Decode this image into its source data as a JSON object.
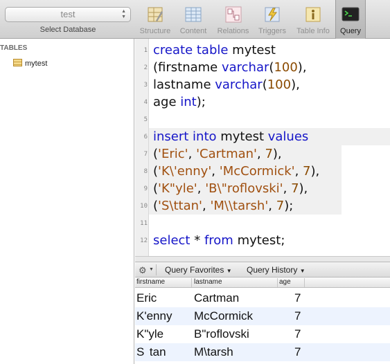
{
  "toolbar": {
    "database": "test",
    "database_caption": "Select Database",
    "buttons": [
      {
        "label": "Structure",
        "icon": "structure-icon"
      },
      {
        "label": "Content",
        "icon": "content-icon"
      },
      {
        "label": "Relations",
        "icon": "relations-icon"
      },
      {
        "label": "Triggers",
        "icon": "triggers-icon"
      },
      {
        "label": "Table Info",
        "icon": "table-info-icon"
      },
      {
        "label": "Query",
        "icon": "query-terminal-icon",
        "active": true
      }
    ]
  },
  "sidebar": {
    "heading": "TABLES",
    "tables": [
      "mytest"
    ]
  },
  "editor": {
    "line_numbers": [
      "1",
      "2",
      "3",
      "4",
      "5",
      "6",
      "7",
      "8",
      "9",
      "10",
      "11",
      "12"
    ],
    "lines": [
      [
        {
          "t": "create table ",
          "c": "kw"
        },
        {
          "t": "mytest",
          "c": ""
        }
      ],
      [
        {
          "t": "(firstname ",
          "c": ""
        },
        {
          "t": "varchar",
          "c": "kw"
        },
        {
          "t": "(",
          "c": ""
        },
        {
          "t": "100",
          "c": "num"
        },
        {
          "t": "),",
          "c": ""
        }
      ],
      [
        {
          "t": "lastname ",
          "c": ""
        },
        {
          "t": "varchar",
          "c": "kw"
        },
        {
          "t": "(",
          "c": ""
        },
        {
          "t": "100",
          "c": "num"
        },
        {
          "t": "),",
          "c": ""
        }
      ],
      [
        {
          "t": "age ",
          "c": ""
        },
        {
          "t": "int",
          "c": "kw"
        },
        {
          "t": ");",
          "c": ""
        }
      ],
      [],
      [
        {
          "t": "insert into ",
          "c": "kw"
        },
        {
          "t": "mytest ",
          "c": ""
        },
        {
          "t": "values",
          "c": "kw"
        }
      ],
      [
        {
          "t": "(",
          "c": ""
        },
        {
          "t": "'Eric'",
          "c": "str"
        },
        {
          "t": ", ",
          "c": ""
        },
        {
          "t": "'Cartman'",
          "c": "str"
        },
        {
          "t": ", ",
          "c": ""
        },
        {
          "t": "7",
          "c": "num"
        },
        {
          "t": "),",
          "c": ""
        }
      ],
      [
        {
          "t": "(",
          "c": ""
        },
        {
          "t": "'K\\'enny'",
          "c": "str"
        },
        {
          "t": ", ",
          "c": ""
        },
        {
          "t": "'McCormick'",
          "c": "str"
        },
        {
          "t": ", ",
          "c": ""
        },
        {
          "t": "7",
          "c": "num"
        },
        {
          "t": "),",
          "c": ""
        }
      ],
      [
        {
          "t": "(",
          "c": ""
        },
        {
          "t": "'K\"yle'",
          "c": "str"
        },
        {
          "t": ", ",
          "c": ""
        },
        {
          "t": "'B\\\"roflovski'",
          "c": "str"
        },
        {
          "t": ", ",
          "c": ""
        },
        {
          "t": "7",
          "c": "num"
        },
        {
          "t": "),",
          "c": ""
        }
      ],
      [
        {
          "t": "(",
          "c": ""
        },
        {
          "t": "'S\\ttan'",
          "c": "str"
        },
        {
          "t": ", ",
          "c": ""
        },
        {
          "t": "'M\\\\tarsh'",
          "c": "str"
        },
        {
          "t": ", ",
          "c": ""
        },
        {
          "t": "7",
          "c": "num"
        },
        {
          "t": ");",
          "c": ""
        }
      ],
      [],
      [
        {
          "t": "select ",
          "c": "kw"
        },
        {
          "t": "* ",
          "c": ""
        },
        {
          "t": "from ",
          "c": "kw"
        },
        {
          "t": "mytest;",
          "c": ""
        }
      ]
    ],
    "highlighted_lines": [
      6,
      7,
      8,
      9,
      10
    ]
  },
  "query_bar": {
    "favorites_label": "Query Favorites",
    "history_label": "Query History"
  },
  "results": {
    "columns": [
      "firstname",
      "lastname",
      "age"
    ],
    "rows": [
      [
        "Eric",
        "Cartman",
        "7"
      ],
      [
        "K'enny",
        "McCormick",
        "7"
      ],
      [
        "K\"yle",
        "B\"roflovski",
        "7"
      ],
      [
        "S\ttan",
        "M\\tarsh",
        "7"
      ]
    ]
  }
}
